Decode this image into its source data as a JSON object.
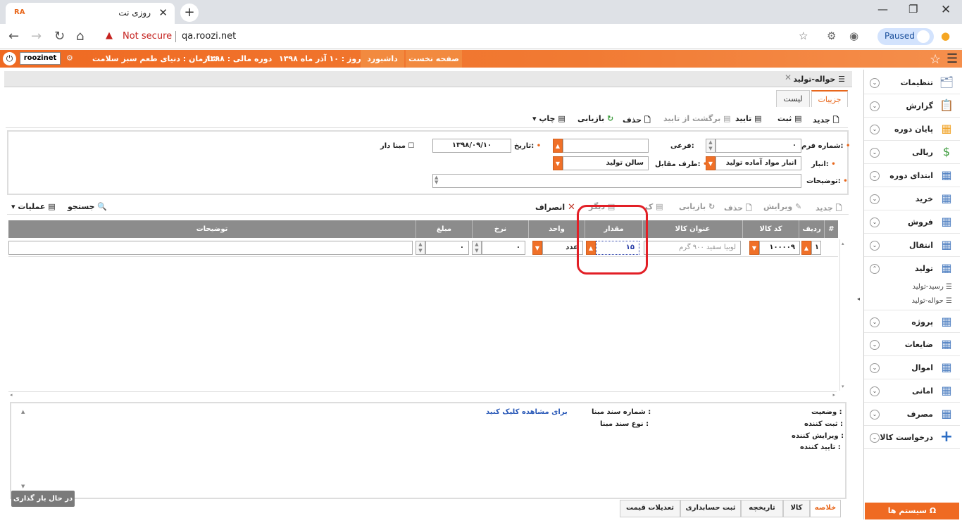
{
  "browser": {
    "tab_title": "روزی نت",
    "favicon_text": "RA",
    "warning": "Not secure",
    "url": "qa.roozi.net",
    "profile_status": "Paused"
  },
  "topbar": {
    "username": "roozinet",
    "organization": "سازمان : دنیای طعم سبز سلامت",
    "fiscal_period": "دوره مالی : ۱۳۹۸",
    "today": "امروز : ۱۰ آذر ماه ۱۳۹۸",
    "dashboard": "داشبورد",
    "home": "صفحه نخست"
  },
  "sidebar": {
    "items": [
      {
        "label": "تنظیمات",
        "icon": "settings-search-icon"
      },
      {
        "label": "گزارش",
        "icon": "clipboard-icon"
      },
      {
        "label": "پایان دوره",
        "icon": "folders-icon"
      },
      {
        "label": "ریالی",
        "icon": "coins-icon"
      },
      {
        "label": "ابتدای دوره",
        "icon": "table-add-icon"
      },
      {
        "label": "خرید",
        "icon": "table-add-icon"
      },
      {
        "label": "فروش",
        "icon": "table-add-icon"
      },
      {
        "label": "انتقال",
        "icon": "table-add-icon"
      },
      {
        "label": "تولید",
        "icon": "table-add-icon"
      }
    ],
    "sub_items": [
      "رسید-تولید",
      "حواله-تولید"
    ],
    "items2": [
      {
        "label": "پروژه",
        "icon": "table-add-icon"
      },
      {
        "label": "ضایعات",
        "icon": "table-add-icon"
      },
      {
        "label": "اموال",
        "icon": "table-add-icon"
      },
      {
        "label": "امانی",
        "icon": "table-add-icon"
      },
      {
        "label": "مصرف",
        "icon": "table-add-icon"
      },
      {
        "label": "درخواست کالا",
        "icon": "plus-icon"
      }
    ],
    "system_button": "سیستم ها"
  },
  "document": {
    "tab_title": "حواله-تولید",
    "view_tabs": {
      "details": "جزییات",
      "list": "لیست"
    }
  },
  "toolbar1": {
    "new": "جدید",
    "save": "ثبت",
    "confirm": "تایید",
    "unconfirm": "برگشت از تایید",
    "delete": "حذف",
    "refresh": "بازیابی",
    "print": "چاپ"
  },
  "form": {
    "form_no_label": "شماره فرم:",
    "form_no_value": "۰",
    "sub_label": "فرعی:",
    "sub_value": "",
    "date_label": "تاریخ:",
    "date_value": "۱۳۹۸/۰۹/۱۰",
    "has_base_label": "مبنا دار",
    "warehouse_label": "انبار:",
    "warehouse_value": "انبار مواد آماده تولید",
    "counterpart_label": "طرف مقابل:",
    "counterpart_value": "سالن تولید",
    "description_label": "توضیحات:",
    "description_value": ""
  },
  "toolbar2": {
    "new": "جدید",
    "edit": "ویرایش",
    "delete": "حذف",
    "refresh": "بازیابی",
    "copy": "ک",
    "other": "دیگر",
    "cancel": "انصراف",
    "search": "جستجو",
    "operations": "عملیات"
  },
  "grid": {
    "columns": [
      "#",
      "ردیف",
      "کد کالا",
      "عنوان کالا",
      "مقدار",
      "واحد",
      "نرخ",
      "مبلغ",
      "توضیحات"
    ],
    "row": {
      "row_no": "۱",
      "code": "۱۰۰۰۰۹",
      "title": "لوبیا سفید ۹۰۰ گرم",
      "quantity": "۱۵",
      "unit": "عدد",
      "rate": "۰",
      "amount": "۰",
      "description": ""
    }
  },
  "summary": {
    "status_label": "وضعیت :",
    "registrar_label": "ثبت کننده :",
    "editor_label": "ویرایش کننده :",
    "approver_label": "تایید کننده :",
    "base_doc_no_label": "شماره سند مبنا :",
    "base_doc_type_label": "نوع سند مبنا :",
    "view_link": "برای مشاهده کلیک کنید"
  },
  "bottom_tabs": [
    "خلاصه",
    "کالا",
    "تاریخچه",
    "ثبت حسابداری",
    "تعدیلات قیمت"
  ],
  "loading_text": "در حال بار گذاری ...",
  "colors": {
    "accent": "#ef6a22",
    "highlight": "#e21f26",
    "grid_header": "#8c8c8c"
  }
}
